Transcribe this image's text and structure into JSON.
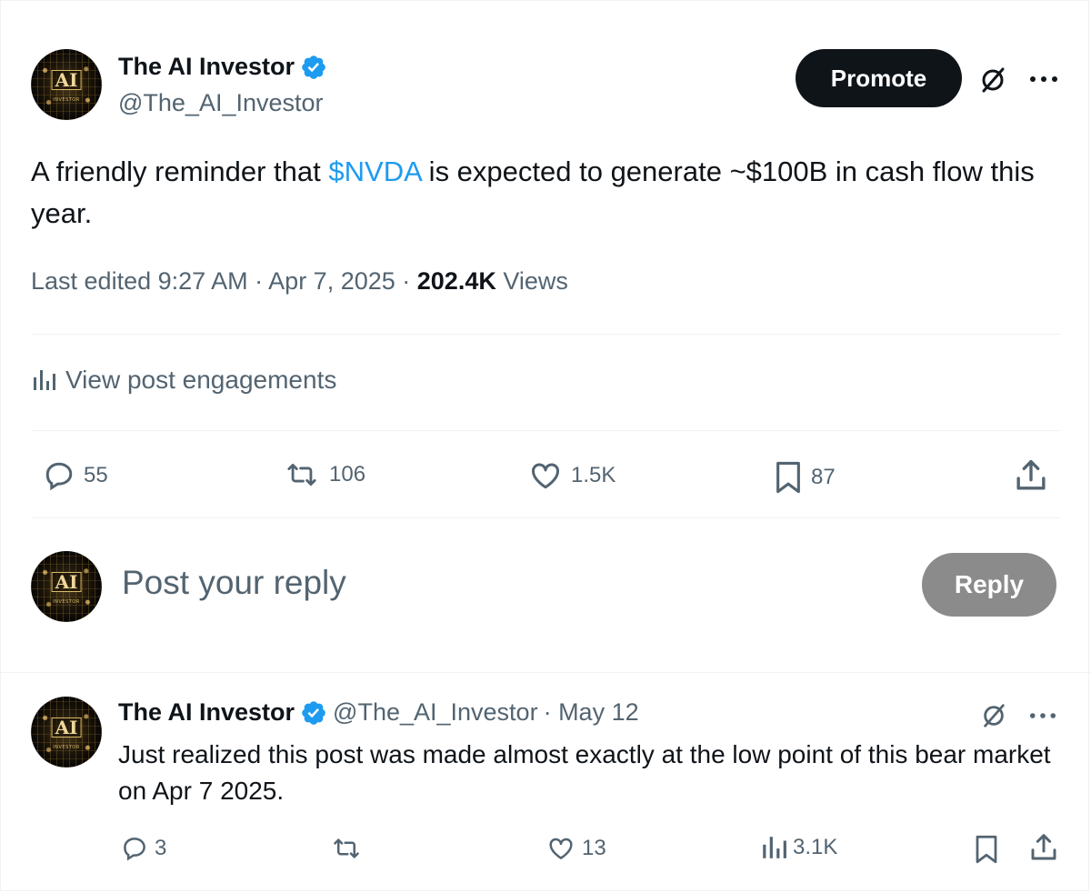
{
  "post": {
    "author_name": "The AI Investor",
    "author_handle": "@The_AI_Investor",
    "promote_label": "Promote",
    "text_before": "A friendly reminder that ",
    "cashtag": "$NVDA",
    "text_after": " is expected to generate ~$100B in cash flow this year.",
    "meta_prefix": "Last edited 9:27 AM · Apr 7, 2025 · ",
    "views_count": "202.4K",
    "views_label": " Views",
    "engagements_label": "View post engagements",
    "replies": "55",
    "reposts": "106",
    "likes": "1.5K",
    "bookmarks": "87"
  },
  "composer": {
    "placeholder": "Post your reply",
    "reply_label": "Reply"
  },
  "reply": {
    "author_name": "The AI Investor",
    "author_handle": "@The_AI_Investor",
    "date": "· May 12",
    "text": "Just realized this post was made almost exactly at the low point of this bear market on Apr 7 2025.",
    "replies": "3",
    "likes": "13",
    "views": "3.1K"
  },
  "avatar_text": {
    "main": "AI",
    "sub": "INVESTOR"
  },
  "colors": {
    "accent": "#1d9bf0",
    "text": "#0f1419",
    "muted": "#536471",
    "divider": "#eff3f4"
  }
}
